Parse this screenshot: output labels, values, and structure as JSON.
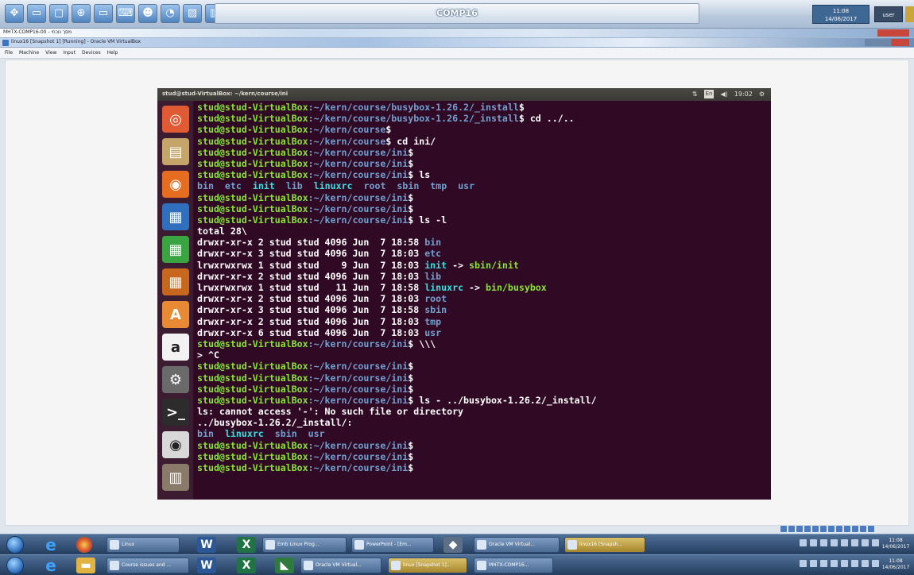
{
  "remote": {
    "title": "COMP16",
    "time": "11:08",
    "date": "14/06/2017",
    "user": "user"
  },
  "windows": {
    "outer_title": "MHTX-COMP16-00 - מסך נוכחי",
    "vbox_title": "linux16 [Snapshot 1] [Running] - Oracle VM VirtualBox"
  },
  "menu": [
    "File",
    "Machine",
    "View",
    "Input",
    "Devices",
    "Help"
  ],
  "guest": {
    "title": "stud@stud-VirtualBox: ~/kern/course/ini",
    "indicators": [
      "⇅",
      "En",
      "◀)",
      "19:02",
      "⚙"
    ],
    "launcher": [
      {
        "name": "ubuntu-dash-icon",
        "glyph": "◎",
        "color": "#e05a33"
      },
      {
        "name": "files-icon",
        "glyph": "▤",
        "color": "#c6a56a"
      },
      {
        "name": "firefox-icon",
        "glyph": "◉",
        "color": "#e66c1f"
      },
      {
        "name": "writer-icon",
        "glyph": "▦",
        "color": "#2f6fbd"
      },
      {
        "name": "calc-icon",
        "glyph": "▦",
        "color": "#3aa540"
      },
      {
        "name": "impress-icon",
        "glyph": "▦",
        "color": "#c7671e"
      },
      {
        "name": "software-center-icon",
        "glyph": "A",
        "color": "#e88a34"
      },
      {
        "name": "amazon-icon",
        "glyph": "a",
        "color": "#f2f2f2"
      },
      {
        "name": "settings-icon",
        "glyph": "⚙",
        "color": "#6a6a6a"
      },
      {
        "name": "terminal-icon",
        "glyph": ">_",
        "color": "#2c2c2c"
      },
      {
        "name": "dvd-icon",
        "glyph": "◉",
        "color": "#d8d8d8"
      },
      {
        "name": "trash-icon",
        "glyph": "▥",
        "color": "#8a7a6a"
      }
    ]
  },
  "terminal": {
    "user": "stud@stud-VirtualBox",
    "lines": [
      {
        "path": ":~/kern/course/busybox-1.26.2/_install",
        "cmd": "$"
      },
      {
        "path": ":~/kern/course/busybox-1.26.2/_install",
        "cmd": "$ cd ../.."
      },
      {
        "path": ":~/kern/course",
        "cmd": "$"
      },
      {
        "path": ":~/kern/course",
        "cmd": "$ cd ini/"
      },
      {
        "path": ":~/kern/course/ini",
        "cmd": "$"
      },
      {
        "path": ":~/kern/course/ini",
        "cmd": "$"
      },
      {
        "path": ":~/kern/course/ini",
        "cmd": "$ ls"
      },
      {
        "parts": [
          [
            "bin",
            "dir"
          ],
          [
            "  ",
            ""
          ],
          [
            "etc",
            "dir"
          ],
          [
            "  ",
            ""
          ],
          [
            "init",
            "link"
          ],
          [
            "  ",
            ""
          ],
          [
            "lib",
            "dir"
          ],
          [
            "  ",
            ""
          ],
          [
            "linuxrc",
            "link"
          ],
          [
            "  ",
            ""
          ],
          [
            "root",
            "dir"
          ],
          [
            "  ",
            ""
          ],
          [
            "sbin",
            "dir"
          ],
          [
            "  ",
            ""
          ],
          [
            "tmp",
            "dir"
          ],
          [
            "  ",
            ""
          ],
          [
            "usr",
            "dir"
          ]
        ]
      },
      {
        "path": ":~/kern/course/ini",
        "cmd": "$"
      },
      {
        "path": ":~/kern/course/ini",
        "cmd": "$"
      },
      {
        "path": ":~/kern/course/ini",
        "cmd": "$ ls -l"
      },
      {
        "parts": [
          [
            "total 28\\",
            ""
          ]
        ]
      },
      {
        "parts": [
          [
            "drwxr-xr-x 2 stud stud 4096 Jun  7 18:58 ",
            ""
          ],
          [
            "bin",
            "dir"
          ]
        ]
      },
      {
        "parts": [
          [
            "drwxr-xr-x 3 stud stud 4096 Jun  7 18:03 ",
            ""
          ],
          [
            "etc",
            "dir"
          ]
        ]
      },
      {
        "parts": [
          [
            "lrwxrwxrwx 1 stud stud    9 Jun  7 18:03 ",
            ""
          ],
          [
            "init",
            "link"
          ],
          [
            " -> ",
            ""
          ],
          [
            "sbin/init",
            "exec"
          ]
        ]
      },
      {
        "parts": [
          [
            "drwxr-xr-x 2 stud stud 4096 Jun  7 18:03 ",
            ""
          ],
          [
            "lib",
            "dir"
          ]
        ]
      },
      {
        "parts": [
          [
            "lrwxrwxrwx 1 stud stud   11 Jun  7 18:58 ",
            ""
          ],
          [
            "linuxrc",
            "link"
          ],
          [
            " -> ",
            ""
          ],
          [
            "bin/busybox",
            "exec"
          ]
        ]
      },
      {
        "parts": [
          [
            "drwxr-xr-x 2 stud stud 4096 Jun  7 18:03 ",
            ""
          ],
          [
            "root",
            "dir"
          ]
        ]
      },
      {
        "parts": [
          [
            "drwxr-xr-x 3 stud stud 4096 Jun  7 18:58 ",
            ""
          ],
          [
            "sbin",
            "dir"
          ]
        ]
      },
      {
        "parts": [
          [
            "drwxr-xr-x 2 stud stud 4096 Jun  7 18:03 ",
            ""
          ],
          [
            "tmp",
            "dir"
          ]
        ]
      },
      {
        "parts": [
          [
            "drwxr-xr-x 6 stud stud 4096 Jun  7 18:03 ",
            ""
          ],
          [
            "usr",
            "dir"
          ]
        ]
      },
      {
        "path": ":~/kern/course/ini",
        "cmd": "$ \\\\\\"
      },
      {
        "parts": [
          [
            "> ^C",
            ""
          ]
        ]
      },
      {
        "path": ":~/kern/course/ini",
        "cmd": "$"
      },
      {
        "path": ":~/kern/course/ini",
        "cmd": "$"
      },
      {
        "path": ":~/kern/course/ini",
        "cmd": "$"
      },
      {
        "path": ":~/kern/course/ini",
        "cmd": "$ ls - ../busybox-1.26.2/_install/"
      },
      {
        "parts": [
          [
            "ls: cannot access '-': No such file or directory",
            ""
          ]
        ]
      },
      {
        "parts": [
          [
            "../busybox-1.26.2/_install/:",
            ""
          ]
        ]
      },
      {
        "parts": [
          [
            "bin",
            "dir"
          ],
          [
            "  ",
            ""
          ],
          [
            "linuxrc",
            "link"
          ],
          [
            "  ",
            ""
          ],
          [
            "sbin",
            "dir"
          ],
          [
            "  ",
            ""
          ],
          [
            "usr",
            "dir"
          ]
        ]
      },
      {
        "path": ":~/kern/course/ini",
        "cmd": "$"
      },
      {
        "path": ":~/kern/course/ini",
        "cmd": "$"
      },
      {
        "path": ":~/kern/course/ini",
        "cmd": "$"
      }
    ]
  },
  "taskbar_top": {
    "tasks": [
      "Linux",
      "Emb Linux Prog...",
      "PowerPoint - [Em...",
      "Oracle VM Virtual...",
      "linux16 [Snapsh..."
    ],
    "time": "11:08",
    "date": "14/06/2017"
  },
  "taskbar_bottom": {
    "tasks": [
      "Course issues and ...",
      "Oracle VM Virtual...",
      "linux [Snapshot 1]...",
      "MHTX-COMP16..."
    ],
    "time": "11:08",
    "date": "14/06/2017"
  },
  "colors": {
    "terminal_bg": "#300a24",
    "prompt_user": "#8ae234",
    "prompt_path": "#729fcf",
    "link": "#34e2e2"
  }
}
